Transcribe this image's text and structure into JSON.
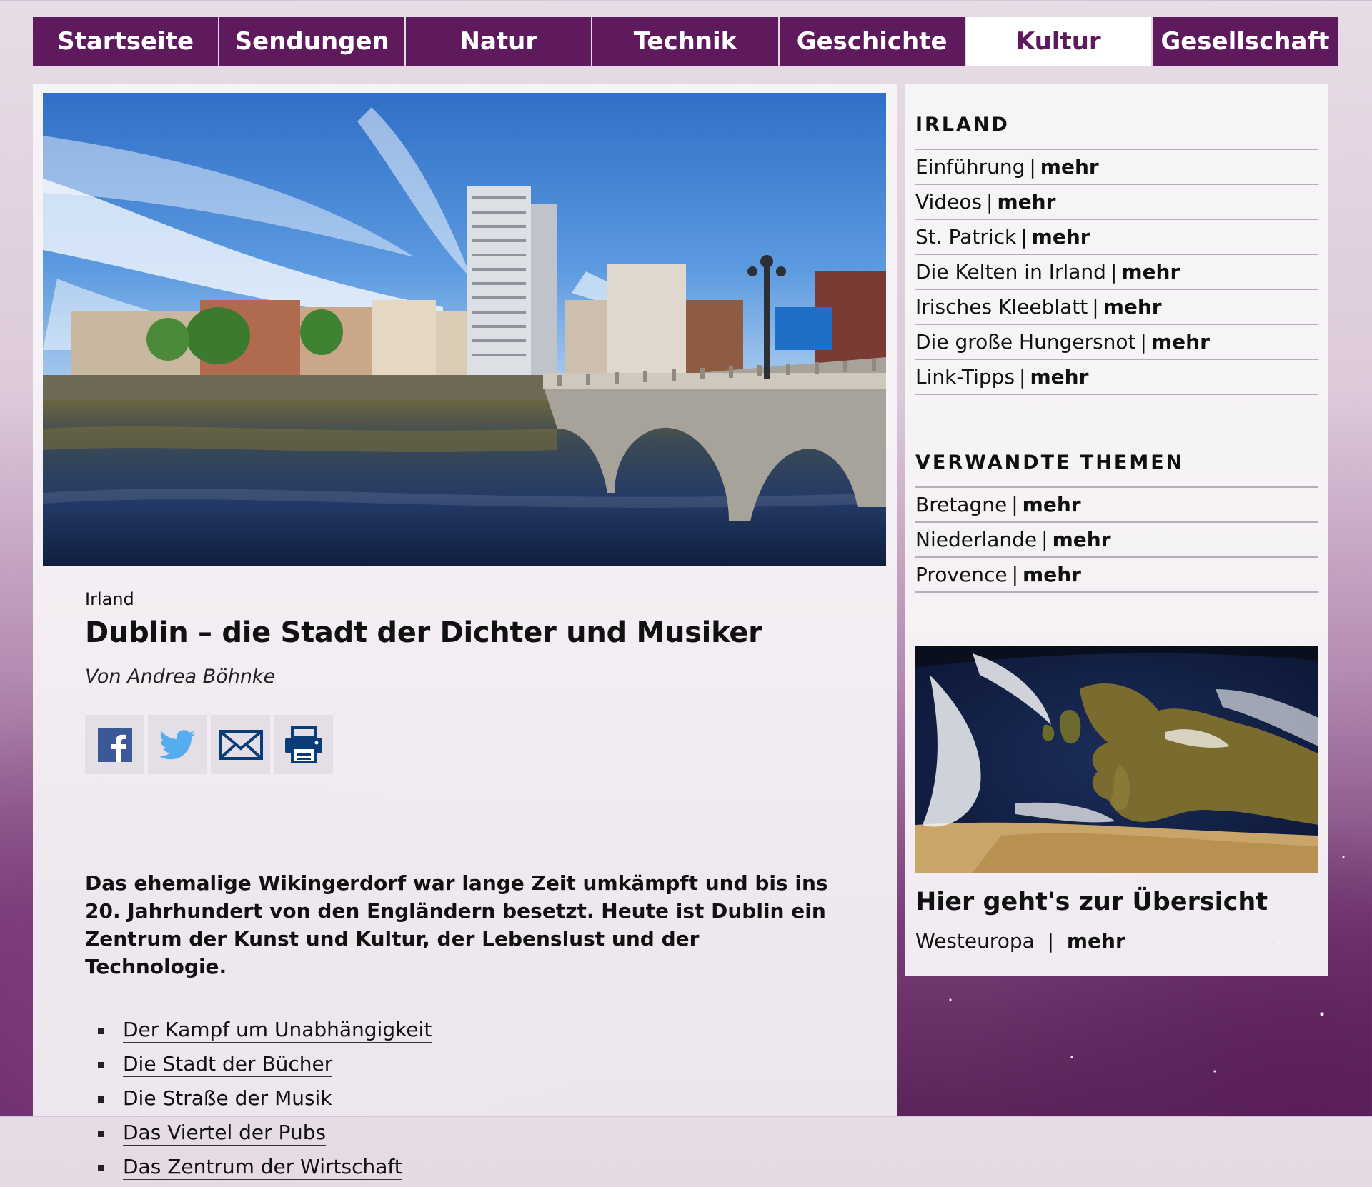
{
  "nav": {
    "tabs": [
      {
        "label": "Startseite"
      },
      {
        "label": "Sendungen"
      },
      {
        "label": "Natur"
      },
      {
        "label": "Technik"
      },
      {
        "label": "Geschichte"
      },
      {
        "label": "Kultur",
        "active": true
      },
      {
        "label": "Gesellschaft"
      }
    ]
  },
  "colors": {
    "brand": "#5e1a5c",
    "nav_active_bg": "#ffffff"
  },
  "article": {
    "kicker": "Irland",
    "headline": "Dublin – die Stadt der Dichter und Musiker",
    "byline": "Von Andrea Böhnke",
    "share": [
      {
        "icon": "facebook-icon"
      },
      {
        "icon": "twitter-icon"
      },
      {
        "icon": "mail-icon"
      },
      {
        "icon": "print-icon"
      }
    ],
    "teaser": "Das ehemalige Wikingerdorf war lange Zeit umkämpft und bis ins 20. Jahrhundert von den Engländern besetzt. Heute ist Dublin ein Zentrum der Kunst und Kultur, der Lebenslust und der Technologie.",
    "toc": [
      "Der Kampf um Unabhängigkeit",
      "Die Stadt der Bücher",
      "Die Straße der Musik",
      "Das Viertel der Pubs",
      "Das Zentrum der Wirtschaft"
    ]
  },
  "sidebar": {
    "irland": {
      "heading": "IRLAND",
      "items": [
        {
          "label": "Einführung",
          "link": "mehr"
        },
        {
          "label": "Videos",
          "link": "mehr"
        },
        {
          "label": "St. Patrick",
          "link": "mehr"
        },
        {
          "label": "Die Kelten in Irland",
          "link": "mehr"
        },
        {
          "label": "Irisches Kleeblatt",
          "link": "mehr"
        },
        {
          "label": "Die große Hungersnot",
          "link": "mehr"
        },
        {
          "label": "Link-Tipps",
          "link": "mehr"
        }
      ]
    },
    "related": {
      "heading": "VERWANDTE THEMEN",
      "items": [
        {
          "label": "Bretagne",
          "link": "mehr"
        },
        {
          "label": "Niederlande",
          "link": "mehr"
        },
        {
          "label": "Provence",
          "link": "mehr"
        }
      ]
    },
    "overview": {
      "title": "Hier geht's zur Übersicht",
      "label": "Westeuropa",
      "sep": "|",
      "link": "mehr"
    }
  }
}
